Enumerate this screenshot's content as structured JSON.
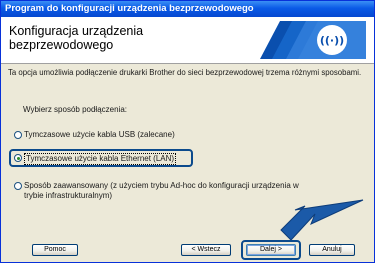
{
  "window": {
    "title": "Program do konfiguracji urządzenia bezprzewodowego"
  },
  "header": {
    "title_line1": "Konfiguracja urządzenia",
    "title_line2": "bezprzewodowego",
    "logo_icon": "wireless-signal-icon"
  },
  "main": {
    "description": "Ta opcja umożliwia podłączenie drukarki Brother do sieci bezprzewodowej trzema różnymi sposobami.",
    "prompt": "Wybierz sposób podłączenia:",
    "options": [
      {
        "label": "Tymczasowe użycie kabla USB (zalecane)",
        "selected": false
      },
      {
        "label": "Tymczasowe użycie kabla Ethernet (LAN)",
        "selected": true
      },
      {
        "label": "Sposób zaawansowany (z użyciem trybu Ad-hoc do konfiguracji urządzenia w trybie infrastrukturalnym)",
        "selected": false
      }
    ]
  },
  "footer": {
    "help_label": "Pomoc",
    "back_label": "< Wstecz",
    "next_label": "Dalej >",
    "cancel_label": "Anuluj"
  },
  "colors": {
    "title_bar": "#0a5ae6",
    "accent": "#0b4a8c",
    "dialog_bg": "#ece9d8"
  }
}
